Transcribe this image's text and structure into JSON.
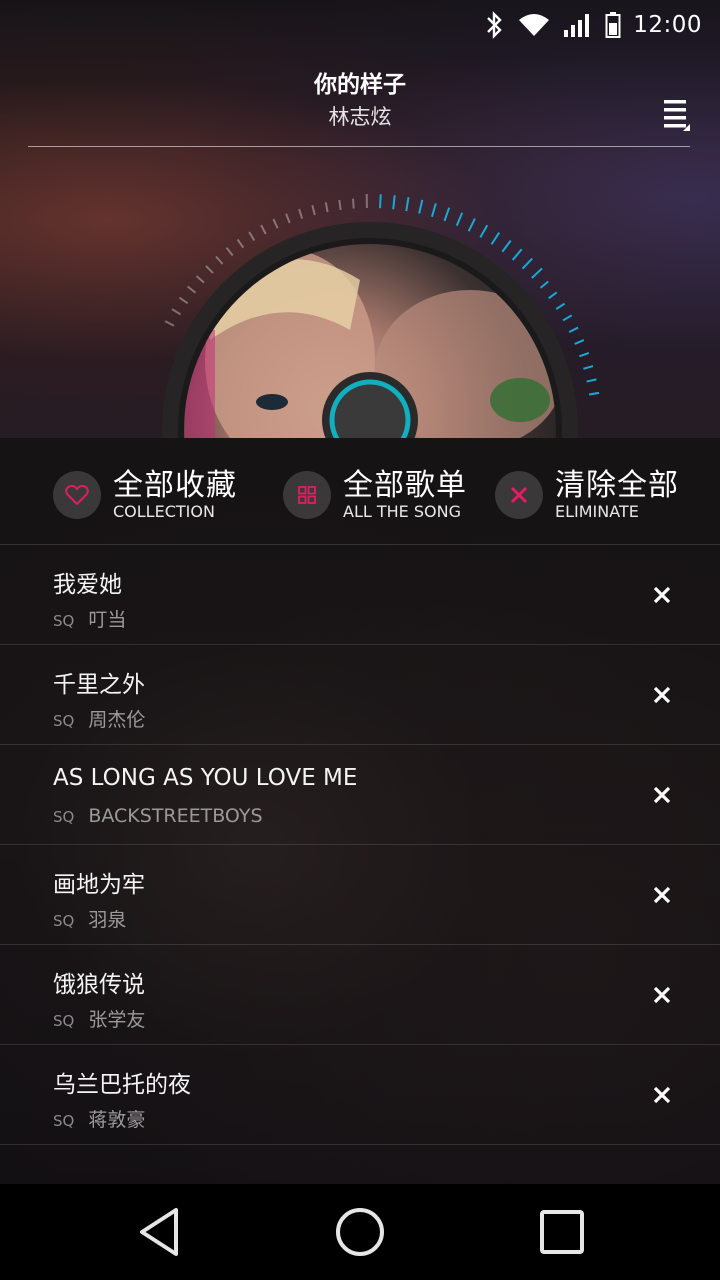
{
  "status_bar": {
    "time": "12:00",
    "icons": [
      "bluetooth-icon",
      "wifi-icon",
      "signal-icon",
      "battery-icon"
    ]
  },
  "now_playing": {
    "title": "你的样子",
    "artist": "林志炫"
  },
  "colors": {
    "accent_cyan": "#1aa9d6",
    "accent_pink": "#e21d63",
    "background": "#120f12"
  },
  "actions": [
    {
      "label_cn": "全部收藏",
      "label_en": "COLLECTION",
      "icon": "heart-icon"
    },
    {
      "label_cn": "全部歌单",
      "label_en": "ALL THE SONG",
      "icon": "grid-icon"
    },
    {
      "label_cn": "清除全部",
      "label_en": "ELIMINATE",
      "icon": "close-icon"
    }
  ],
  "songs": [
    {
      "title": "我爱她",
      "quality": "SQ",
      "artist": "叮当"
    },
    {
      "title": "千里之外",
      "quality": "SQ",
      "artist": "周杰伦"
    },
    {
      "title": "AS LONG AS YOU LOVE ME",
      "quality": "SQ",
      "artist": "BACKSTREETBOYS"
    },
    {
      "title": "画地为牢",
      "quality": "SQ",
      "artist": "羽泉"
    },
    {
      "title": "饿狼传说",
      "quality": "SQ",
      "artist": "张学友"
    },
    {
      "title": "乌兰巴托的夜",
      "quality": "SQ",
      "artist": "蒋敦豪"
    }
  ],
  "nav": [
    "back-icon",
    "home-icon",
    "recents-icon"
  ]
}
